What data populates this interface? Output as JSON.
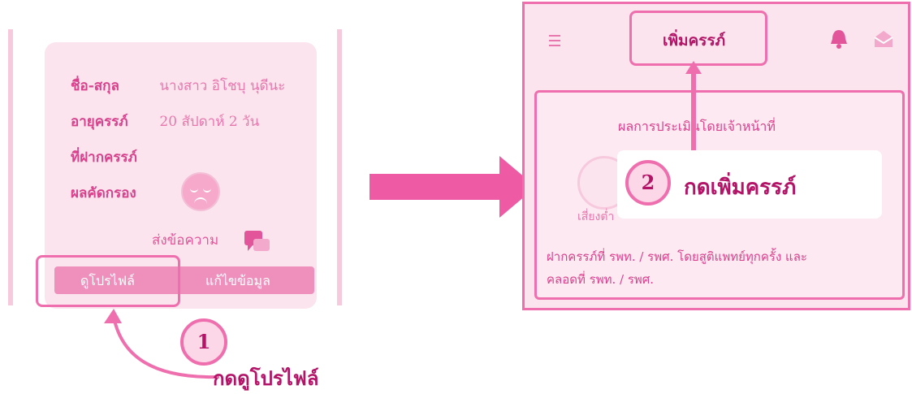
{
  "profile_card": {
    "rows": [
      {
        "label": "ชื่อ-สกุล",
        "value": "นางสาว อิโชบุ นุดีนะ"
      },
      {
        "label": "อายุครรภ์",
        "value": "20 สัปดาห์ 2 วัน"
      },
      {
        "label": "ที่ฝากครรภ์",
        "value": ""
      },
      {
        "label": "ผลคัดกรอง",
        "value": ""
      }
    ],
    "screening_icon": "sad-face-icon",
    "send_message": "ส่งข้อความ",
    "tabs": {
      "view_profile": "ดูโปรไฟล์",
      "edit_info": "แก้ไขข้อมูล"
    }
  },
  "steps": [
    {
      "number": "1",
      "label": "กดดูโปรไฟล์"
    },
    {
      "number": "2",
      "label": "กดเพิ่มครรภ์"
    }
  ],
  "pregnancy_screen": {
    "title": "เพิ่มครรภ์",
    "panel_title": "ผลการประเมินโดยเจ้าหน้าที่",
    "ghost_label": "เสี่ยงต่ำ",
    "panel_text_1": "ฝากครรภ์ที่ รพท. / รพศ. โดยสูติแพทย์ทุกครั้ง และ",
    "panel_text_2": "คลอดที่ รพท. / รพศ."
  },
  "colors": {
    "accent": "#ef6fae",
    "dark": "#b31467",
    "soft": "#fce4ee"
  }
}
